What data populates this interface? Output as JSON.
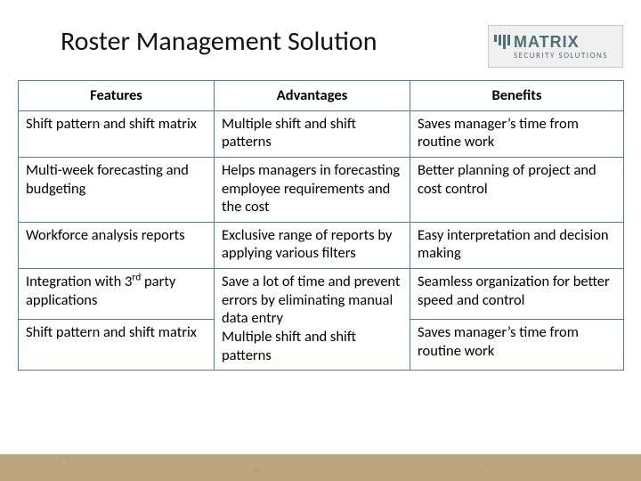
{
  "title": "Roster Management Solution",
  "logo": {
    "brand": "MATRIX",
    "tagline": "SECURITY SOLUTIONS"
  },
  "table": {
    "headers": [
      "Features",
      "Advantages",
      "Benefits"
    ],
    "rows": [
      {
        "feature": "Shift pattern and shift matrix",
        "advantage": "Multiple shift and shift patterns",
        "benefit": "Saves manager’s time from routine work"
      },
      {
        "feature": "Multi-week forecasting and budgeting",
        "advantage": "Helps managers in forecasting employee requirements and the cost",
        "benefit": "Better planning of project and cost control"
      },
      {
        "feature": "Workforce analysis reports",
        "advantage": "Exclusive range of reports by applying various filters",
        "benefit": "Easy interpretation and decision making"
      },
      {
        "feature_html": "Integration with 3<sup>rd</sup> party applications",
        "feature": "Integration with 3rd party applications",
        "advantage": "Save a lot of time and prevent errors by eliminating manual data entry",
        "benefit": "Seamless organization for better speed and control"
      },
      {
        "feature": "Shift pattern and shift matrix",
        "advantage": "Multiple shift and shift patterns",
        "benefit": "Saves manager’s time from routine work"
      }
    ],
    "merges": [
      {
        "col": "advantage",
        "startRow": 3,
        "span": 2
      }
    ]
  }
}
